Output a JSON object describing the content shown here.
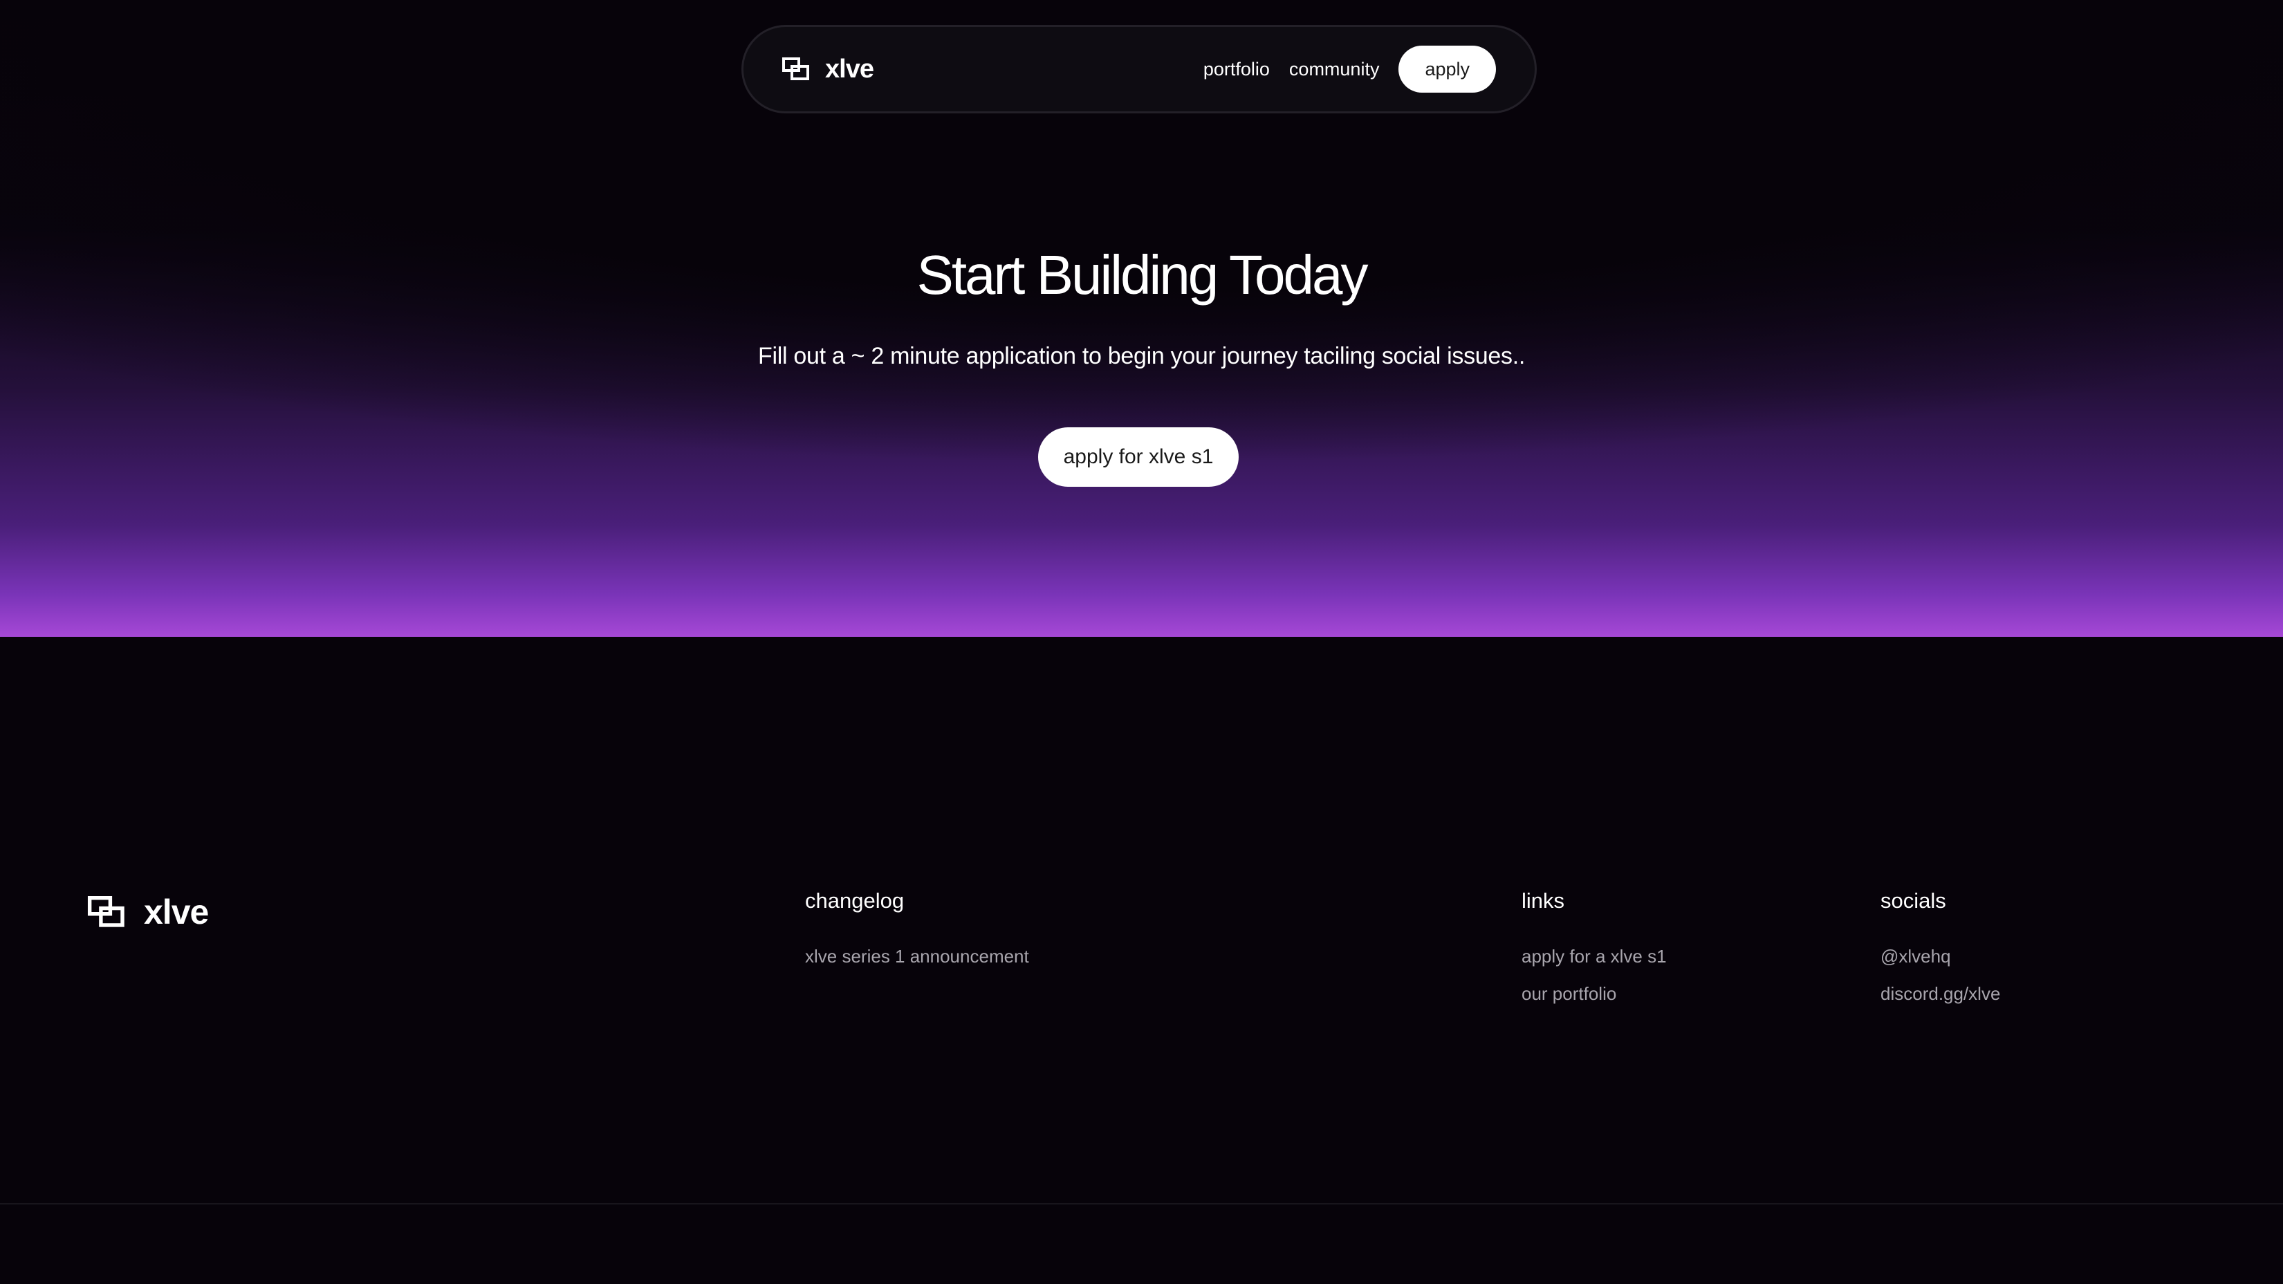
{
  "nav": {
    "brand": "xlve",
    "links": [
      "portfolio",
      "community"
    ],
    "apply_label": "apply"
  },
  "hero": {
    "title": "Start Building Today",
    "subtitle": "Fill out a ~ 2 minute application to begin your journey taciling social issues..",
    "cta_label": "apply for xlve s1"
  },
  "footer": {
    "brand": "xlve",
    "columns": [
      {
        "title": "changelog",
        "items": [
          "xlve series 1 announcement"
        ]
      },
      {
        "title": "links",
        "items": [
          "apply for a xlve s1",
          "our portfolio"
        ]
      },
      {
        "title": "socials",
        "items": [
          "@xlvehq",
          "discord.gg/xlve"
        ]
      }
    ]
  },
  "colors": {
    "background": "#07030a",
    "gradient_bottom": "#a648d6",
    "button_bg": "#ffffff"
  }
}
